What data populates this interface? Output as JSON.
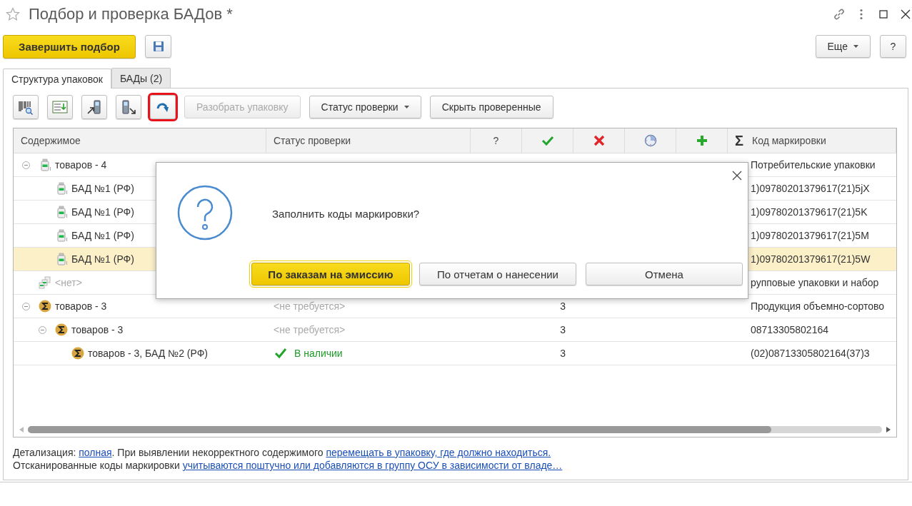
{
  "window": {
    "title": "Подбор и проверка БАДов *"
  },
  "command_bar": {
    "primary_button": "Завершить подбор",
    "more_button": "Еще",
    "help_button": "?"
  },
  "tabs": [
    {
      "label": "Структура упаковок",
      "selected": true
    },
    {
      "label": "БАДы (2)",
      "selected": false
    }
  ],
  "toolbar": {
    "icon_buttons": [
      {
        "kind": "barcode",
        "highlighted": false
      },
      {
        "kind": "list",
        "highlighted": false
      },
      {
        "kind": "device-up",
        "highlighted": false
      },
      {
        "kind": "device-down",
        "highlighted": false
      },
      {
        "kind": "redo",
        "highlighted": true
      }
    ],
    "buttons": [
      {
        "label": "Разобрать упаковку",
        "disabled": true,
        "dropdown": false
      },
      {
        "label": "Статус проверки",
        "disabled": false,
        "dropdown": true
      },
      {
        "label": "Скрыть проверенные",
        "disabled": false,
        "dropdown": false
      }
    ]
  },
  "table": {
    "columns": [
      {
        "kind": "text",
        "label": "Содержимое"
      },
      {
        "kind": "text",
        "label": "Статус проверки"
      },
      {
        "kind": "text",
        "label": "?"
      },
      {
        "kind": "check"
      },
      {
        "kind": "cross"
      },
      {
        "kind": "clock"
      },
      {
        "kind": "plus"
      },
      {
        "kind": "text",
        "label": "Σ"
      },
      {
        "kind": "text",
        "label": "Код маркировки"
      }
    ],
    "rows": [
      {
        "kind": "bottle",
        "label": "товаров - 4",
        "muted": false,
        "selected": false,
        "expanded": true,
        "code": "Потребительские упаковки",
        "children": [
          {
            "kind": "bottle",
            "label": "БАД №1 (РФ)",
            "muted": false,
            "selected": false,
            "code": "1)09780201379617(21)5jX"
          },
          {
            "kind": "bottle",
            "label": "БАД №1 (РФ)",
            "muted": false,
            "selected": false,
            "code": "1)09780201379617(21)5K"
          },
          {
            "kind": "bottle",
            "label": "БАД №1 (РФ)",
            "muted": false,
            "selected": false,
            "code": "1)09780201379617(21)5M"
          },
          {
            "kind": "bottle",
            "label": "БАД №1 (РФ)",
            "muted": false,
            "selected": true,
            "code": "1)09780201379617(21)5W"
          }
        ]
      },
      {
        "kind": "group",
        "label": "<нет>",
        "muted": true,
        "selected": false,
        "code": "рупповые упаковки и набор"
      },
      {
        "kind": "sigma",
        "label": "товаров - 3",
        "muted": false,
        "selected": false,
        "expanded": true,
        "status": {
          "kind": "placeholder",
          "text": "<не требуется>"
        },
        "count": "3",
        "code": "Продукция объемно-сортово",
        "children": [
          {
            "kind": "sigma",
            "label": "товаров - 3",
            "muted": false,
            "selected": false,
            "expanded": true,
            "status": {
              "kind": "placeholder",
              "text": "<не требуется>"
            },
            "count": "3",
            "code": "08713305802164",
            "children": [
              {
                "kind": "sigma",
                "label": "товаров - 3, БАД №2 (РФ)",
                "muted": false,
                "selected": false,
                "status": {
                  "kind": "ok",
                  "text": "В наличии"
                },
                "count": "3",
                "code": "(02)08713305802164(37)3"
              }
            ]
          }
        ]
      }
    ]
  },
  "hint_lines": [
    [
      {
        "kind": "text",
        "text": "Детализация: "
      },
      {
        "kind": "link",
        "text": "полная"
      },
      {
        "kind": "text",
        "text": ". При выявлении некорректного содержимого "
      },
      {
        "kind": "link",
        "text": "перемещать в упаковку, где должно находиться."
      }
    ],
    [
      {
        "kind": "text",
        "text": "Отсканированные коды маркировки "
      },
      {
        "kind": "link",
        "text": "учитываются поштучно или добавляются в группу ОСУ в зависимости от владе…"
      }
    ]
  ],
  "dialog": {
    "message": "Заполнить коды маркировки?",
    "buttons": [
      {
        "label": "По заказам на эмиссию",
        "default": true
      },
      {
        "label": "По отчетам о нанесении",
        "default": false
      },
      {
        "label": "Отмена",
        "default": false
      }
    ]
  }
}
